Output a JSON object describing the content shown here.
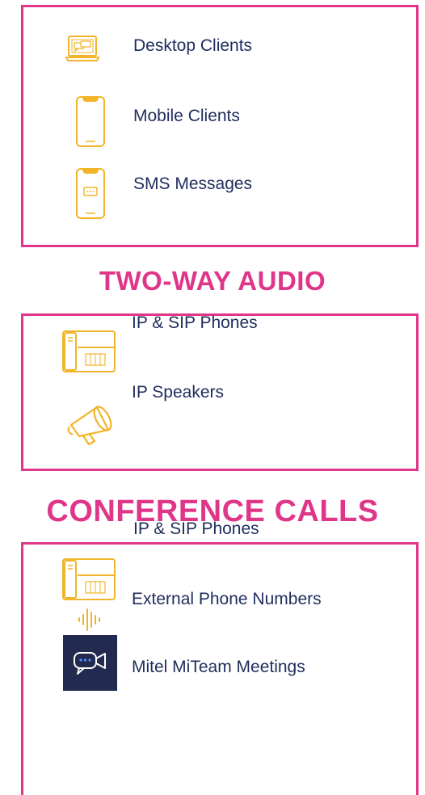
{
  "section1": {
    "items": [
      {
        "label": "Desktop Clients",
        "icon": "laptop-chat-icon"
      },
      {
        "label": "Mobile Clients",
        "icon": "smartphone-icon"
      },
      {
        "label": "SMS Messages",
        "icon": "smartphone-sms-icon"
      }
    ]
  },
  "section2": {
    "heading": "TWO-WAY AUDIO",
    "items": [
      {
        "label": "IP & SIP Phones",
        "icon": "desk-phone-icon"
      },
      {
        "label": "IP Speakers",
        "icon": "megaphone-icon"
      }
    ]
  },
  "section3": {
    "heading": "CONFERENCE CALLS",
    "items": [
      {
        "label": "IP & SIP Phones",
        "icon": "desk-phone-icon"
      },
      {
        "label": "External Phone Numbers",
        "icon": "sound-wave-icon"
      },
      {
        "label": "Mitel MiTeam Meetings",
        "icon": "video-chat-icon"
      }
    ]
  },
  "colors": {
    "accent": "#e0368a",
    "icon": "#f2b52a",
    "text": "#1f2d5c",
    "tile": "#232a4f"
  }
}
